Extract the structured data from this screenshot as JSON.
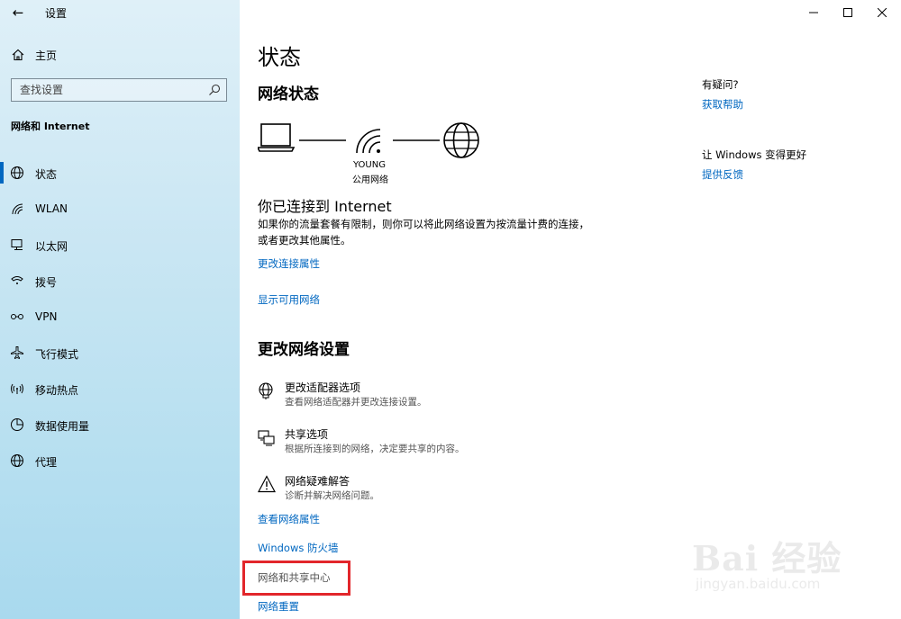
{
  "window": {
    "title": "设置",
    "controls": [
      "minimize-icon",
      "maximize-icon",
      "close-icon"
    ]
  },
  "sidebar": {
    "home_label": "主页",
    "search_placeholder": "查找设置",
    "section_heading": "网络和 Internet",
    "items": [
      {
        "label": "状态",
        "icon": "status-globe-icon",
        "active": true
      },
      {
        "label": "WLAN",
        "icon": "wifi-icon",
        "active": false
      },
      {
        "label": "以太网",
        "icon": "ethernet-icon",
        "active": false
      },
      {
        "label": "拨号",
        "icon": "dialup-icon",
        "active": false
      },
      {
        "label": "VPN",
        "icon": "vpn-icon",
        "active": false
      },
      {
        "label": "飞行模式",
        "icon": "airplane-icon",
        "active": false
      },
      {
        "label": "移动热点",
        "icon": "hotspot-icon",
        "active": false
      },
      {
        "label": "数据使用量",
        "icon": "data-usage-icon",
        "active": false
      },
      {
        "label": "代理",
        "icon": "proxy-globe-icon",
        "active": false
      }
    ]
  },
  "main": {
    "page_title": "状态",
    "network_status_title": "网络状态",
    "network": {
      "name": "YOUNG",
      "type": "公用网络"
    },
    "connected_title": "你已连接到 Internet",
    "connected_desc": "如果你的流量套餐有限制，则你可以将此网络设置为按流量计费的连接，或者更改其他属性。",
    "link_change_props": "更改连接属性",
    "link_show_networks": "显示可用网络",
    "change_settings_title": "更改网络设置",
    "options": [
      {
        "title": "更改适配器选项",
        "desc": "查看网络适配器并更改连接设置。",
        "icon": "adapter-globe-icon"
      },
      {
        "title": "共享选项",
        "desc": "根据所连接到的网络，决定要共享的内容。",
        "icon": "sharing-icon"
      },
      {
        "title": "网络疑难解答",
        "desc": "诊断并解决网络问题。",
        "icon": "warning-icon"
      }
    ],
    "link_view_props": "查看网络属性",
    "link_firewall": "Windows 防火墙",
    "link_sharing_center": "网络和共享中心",
    "link_reset": "网络重置"
  },
  "aside": {
    "question": "有疑问?",
    "get_help": "获取帮助",
    "improve": "让 Windows 变得更好",
    "feedback": "提供反馈"
  },
  "watermark": {
    "text": "Bai 经验",
    "sub": "jingyan.baidu.com"
  },
  "colors": {
    "accent": "#0067c0",
    "highlight": "#e2262b"
  }
}
